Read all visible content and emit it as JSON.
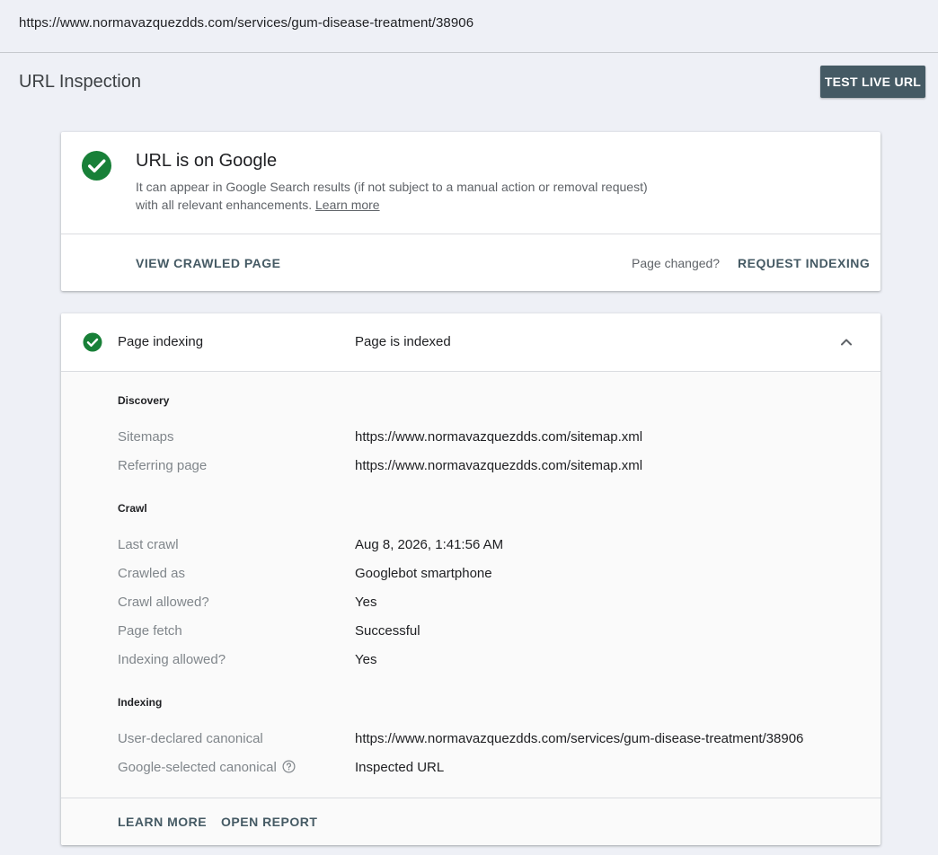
{
  "address_bar": {
    "url": "https://www.normavazquezdds.com/services/gum-disease-treatment/38906"
  },
  "header": {
    "title": "URL Inspection",
    "test_live_url_label": "TEST LIVE URL"
  },
  "status_card": {
    "icon": "check-circle-icon",
    "title": "URL is on Google",
    "description": "It can appear in Google Search results (if not subject to a manual action or removal request) with all relevant enhancements.",
    "learn_more_label": "Learn more",
    "view_crawled_label": "VIEW CRAWLED PAGE",
    "page_changed_label": "Page changed?",
    "request_indexing_label": "REQUEST INDEXING"
  },
  "indexing_card": {
    "icon": "check-circle-icon",
    "label": "Page indexing",
    "value": "Page is indexed",
    "expanded_icon": "chevron-up-icon",
    "discovery": {
      "title": "Discovery",
      "rows": [
        {
          "label": "Sitemaps",
          "value": "https://www.normavazquezdds.com/sitemap.xml"
        },
        {
          "label": "Referring page",
          "value": "https://www.normavazquezdds.com/sitemap.xml"
        }
      ]
    },
    "crawl": {
      "title": "Crawl",
      "rows": [
        {
          "label": "Last crawl",
          "value": "Aug 8, 2026, 1:41:56 AM"
        },
        {
          "label": "Crawled as",
          "value": "Googlebot smartphone"
        },
        {
          "label": "Crawl allowed?",
          "value": "Yes"
        },
        {
          "label": "Page fetch",
          "value": "Successful"
        },
        {
          "label": "Indexing allowed?",
          "value": "Yes"
        }
      ]
    },
    "indexing": {
      "title": "Indexing",
      "rows": [
        {
          "label": "User-declared canonical",
          "value": "https://www.normavazquezdds.com/services/gum-disease-treatment/38906"
        },
        {
          "label": "Google-selected canonical",
          "value": "Inspected URL",
          "help_icon": "help-circle-icon"
        }
      ]
    },
    "footer": {
      "learn_more_label": "LEARN MORE",
      "open_report_label": "OPEN REPORT"
    }
  },
  "colors": {
    "success": "#188038",
    "button": "#455a64",
    "background": "#eef0f6"
  }
}
